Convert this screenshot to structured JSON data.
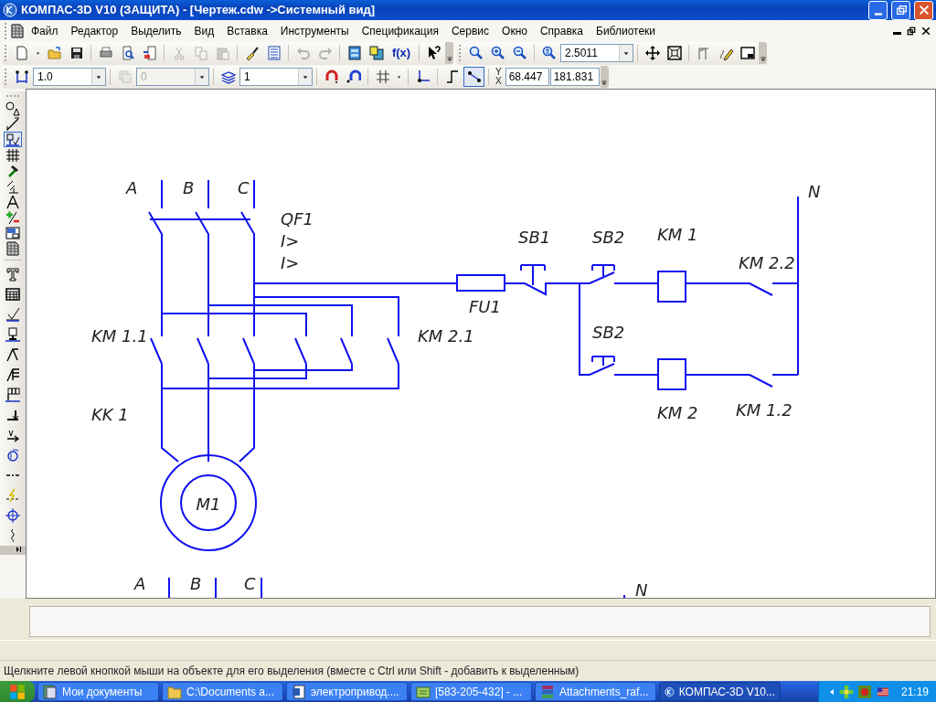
{
  "window": {
    "title": "КОМПАС-3D V10 (ЗАЩИТА) - [Чертеж.cdw ->Системный вид]"
  },
  "menu": [
    "Файл",
    "Редактор",
    "Выделить",
    "Вид",
    "Вставка",
    "Инструменты",
    "Спецификация",
    "Сервис",
    "Окно",
    "Справка",
    "Библиотеки"
  ],
  "toolbar_main": [
    {
      "kind": "new",
      "disabled": false
    },
    {
      "kind": "caret"
    },
    {
      "kind": "open",
      "disabled": false
    },
    {
      "kind": "save",
      "disabled": false
    },
    {
      "kind": "sep"
    },
    {
      "kind": "print",
      "disabled": false
    },
    {
      "kind": "preview",
      "disabled": false
    },
    {
      "kind": "export",
      "disabled": false
    },
    {
      "kind": "sep"
    },
    {
      "kind": "cut",
      "disabled": true
    },
    {
      "kind": "copy",
      "disabled": true
    },
    {
      "kind": "paste",
      "disabled": true
    },
    {
      "kind": "sep"
    },
    {
      "kind": "brush",
      "disabled": false
    },
    {
      "kind": "list",
      "disabled": false
    },
    {
      "kind": "sep"
    },
    {
      "kind": "undo",
      "disabled": true
    },
    {
      "kind": "redo",
      "disabled": true
    },
    {
      "kind": "sep"
    },
    {
      "kind": "panel",
      "disabled": false
    },
    {
      "kind": "help",
      "disabled": false
    },
    {
      "kind": "text",
      "label": "f(x)",
      "disabled": false
    },
    {
      "kind": "sep"
    },
    {
      "kind": "whatsthis",
      "disabled": false
    },
    {
      "kind": "grip"
    },
    {
      "kind": "gap"
    },
    {
      "kind": "zoom",
      "disabled": false
    },
    {
      "kind": "zoomin",
      "disabled": false
    },
    {
      "kind": "zoomout",
      "disabled": false
    },
    {
      "kind": "sep"
    },
    {
      "kind": "zoomscale",
      "disabled": false
    },
    {
      "kind": "combo",
      "value": "2.5011",
      "disabled": false
    },
    {
      "kind": "sep"
    },
    {
      "kind": "move",
      "disabled": false
    },
    {
      "kind": "fit",
      "disabled": false
    },
    {
      "kind": "sep"
    },
    {
      "kind": "tower",
      "disabled": false
    },
    {
      "kind": "pencil",
      "disabled": false
    },
    {
      "kind": "window",
      "disabled": false
    },
    {
      "kind": "grip"
    }
  ],
  "toolbar_current": [
    {
      "kind": "step",
      "disabled": false,
      "selected": false
    },
    {
      "kind": "combo",
      "value": "1.0",
      "disabled": false
    },
    {
      "kind": "sep"
    },
    {
      "kind": "layer",
      "disabled": true,
      "selected": false
    },
    {
      "kind": "combo",
      "value": "0",
      "disabled": true
    },
    {
      "kind": "sep"
    },
    {
      "kind": "layers",
      "disabled": false,
      "selected": false
    },
    {
      "kind": "combo",
      "value": "1",
      "disabled": false
    },
    {
      "kind": "sep"
    },
    {
      "kind": "magnet",
      "disabled": false,
      "selected": false
    },
    {
      "kind": "magnet2",
      "disabled": false,
      "selected": false
    },
    {
      "kind": "sep"
    },
    {
      "kind": "grid",
      "disabled": false,
      "selected": false
    },
    {
      "kind": "caret"
    },
    {
      "kind": "sep"
    },
    {
      "kind": "axes",
      "disabled": false,
      "selected": false
    },
    {
      "kind": "sep"
    },
    {
      "kind": "ortho",
      "disabled": false,
      "selected": false
    },
    {
      "kind": "snapline",
      "disabled": false,
      "selected": true
    },
    {
      "kind": "sep"
    },
    {
      "kind": "coords",
      "labels": [
        "Y",
        "X"
      ]
    },
    {
      "kind": "field",
      "value": "68.447"
    },
    {
      "kind": "field",
      "value": "181.831"
    },
    {
      "kind": "grip"
    }
  ],
  "tools": [
    {
      "kind": "geometry",
      "selected": false
    },
    {
      "kind": "dimension",
      "selected": false
    },
    {
      "kind": "designation",
      "selected": true
    },
    {
      "kind": "editing",
      "selected": false
    },
    {
      "kind": "param",
      "selected": false
    },
    {
      "kind": "measure",
      "selected": false
    },
    {
      "kind": "compass",
      "selected": false
    },
    {
      "kind": "plusminus",
      "selected": false
    },
    {
      "kind": "views",
      "selected": false
    },
    {
      "kind": "spec",
      "selected": false
    },
    {
      "kind": "sep"
    },
    {
      "kind": "texttool",
      "selected": false
    },
    {
      "kind": "table",
      "selected": false
    },
    {
      "kind": "rough",
      "selected": false
    },
    {
      "kind": "base",
      "selected": false
    },
    {
      "kind": "leader",
      "selected": false
    },
    {
      "kind": "posleader",
      "selected": false
    },
    {
      "kind": "tolerance",
      "selected": false
    },
    {
      "kind": "cutline",
      "selected": false
    },
    {
      "kind": "viewarrow",
      "selected": false
    },
    {
      "kind": "wave",
      "selected": false
    },
    {
      "kind": "axisline",
      "selected": false
    },
    {
      "kind": "break",
      "selected": false
    },
    {
      "kind": "center",
      "selected": false
    },
    {
      "kind": "squiggle",
      "selected": false
    }
  ],
  "drawing": {
    "labels": [
      "A",
      "B",
      "C",
      "QF1",
      "I>",
      "I>",
      "SB1",
      "SB2",
      "KM 1",
      "KM 2.2",
      "N",
      "FU1",
      "KM 1.1",
      "KM 2.1",
      "SB2",
      "KK 1",
      "KM 2",
      "KM 1.2",
      "M1",
      "A",
      "B",
      "C",
      "N"
    ]
  },
  "status_bar": {
    "message": "Щелкните левой кнопкой мыши на объекте для его выделения (вместе с Ctrl или Shift - добавить к выделенным)"
  },
  "taskbar": {
    "items": [
      {
        "kind": "folderdoc",
        "label": "Мои документы",
        "selected": false
      },
      {
        "kind": "folder",
        "label": "C:\\Documents a...",
        "selected": false
      },
      {
        "kind": "word",
        "label": "электропривод....",
        "selected": false
      },
      {
        "kind": "chat",
        "label": "[583-205-432] - ...",
        "selected": false
      },
      {
        "kind": "archive",
        "label": "Attachments_raf...",
        "selected": false
      },
      {
        "kind": "kompas",
        "label": "КОМПАС-3D V10...",
        "selected": true
      }
    ],
    "clock": "21:19"
  }
}
